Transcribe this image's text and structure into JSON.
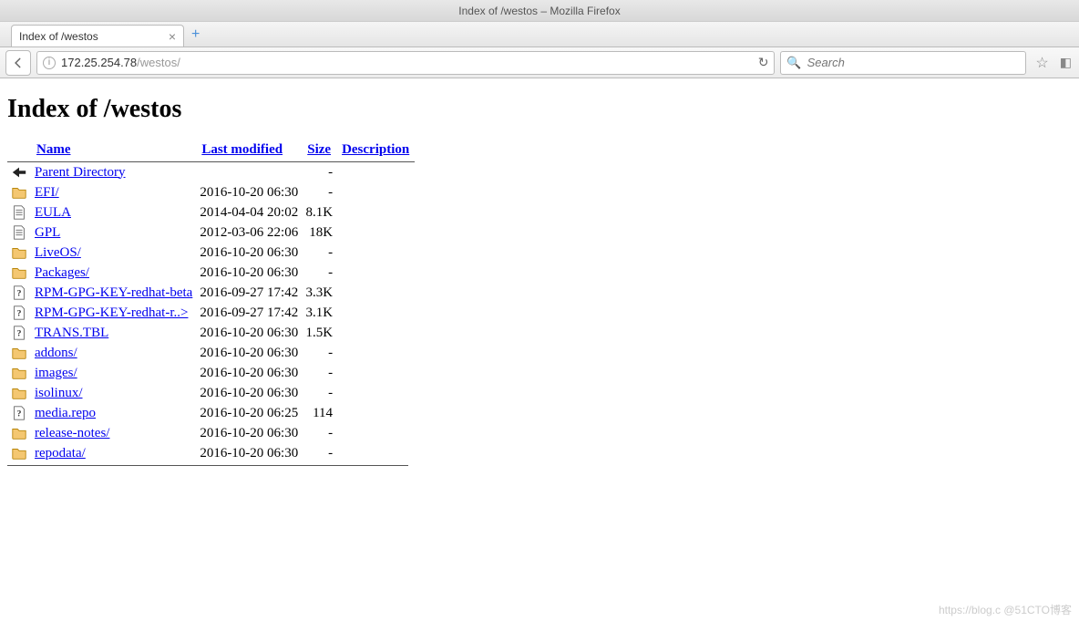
{
  "window_title": "Index of /westos – Mozilla Firefox",
  "tab": {
    "title": "Index of /westos"
  },
  "url": {
    "host": "172.25.254.78",
    "path": "/westos/"
  },
  "search": {
    "placeholder": "Search"
  },
  "page": {
    "heading": "Index of /westos",
    "columns": {
      "name": "Name",
      "modified": "Last modified",
      "size": "Size",
      "desc": "Description"
    },
    "rows": [
      {
        "icon": "back",
        "name": "Parent Directory",
        "modified": "",
        "size": "-",
        "desc": ""
      },
      {
        "icon": "folder",
        "name": "EFI/",
        "modified": "2016-10-20 06:30",
        "size": "-",
        "desc": ""
      },
      {
        "icon": "text",
        "name": "EULA",
        "modified": "2014-04-04 20:02",
        "size": "8.1K",
        "desc": ""
      },
      {
        "icon": "text",
        "name": "GPL",
        "modified": "2012-03-06 22:06",
        "size": "18K",
        "desc": ""
      },
      {
        "icon": "folder",
        "name": "LiveOS/",
        "modified": "2016-10-20 06:30",
        "size": "-",
        "desc": ""
      },
      {
        "icon": "folder",
        "name": "Packages/",
        "modified": "2016-10-20 06:30",
        "size": "-",
        "desc": ""
      },
      {
        "icon": "unknown",
        "name": "RPM-GPG-KEY-redhat-beta",
        "modified": "2016-09-27 17:42",
        "size": "3.3K",
        "desc": ""
      },
      {
        "icon": "unknown",
        "name": "RPM-GPG-KEY-redhat-r..>",
        "modified": "2016-09-27 17:42",
        "size": "3.1K",
        "desc": ""
      },
      {
        "icon": "unknown",
        "name": "TRANS.TBL",
        "modified": "2016-10-20 06:30",
        "size": "1.5K",
        "desc": ""
      },
      {
        "icon": "folder",
        "name": "addons/",
        "modified": "2016-10-20 06:30",
        "size": "-",
        "desc": ""
      },
      {
        "icon": "folder",
        "name": "images/",
        "modified": "2016-10-20 06:30",
        "size": "-",
        "desc": ""
      },
      {
        "icon": "folder",
        "name": "isolinux/",
        "modified": "2016-10-20 06:30",
        "size": "-",
        "desc": ""
      },
      {
        "icon": "unknown",
        "name": "media.repo",
        "modified": "2016-10-20 06:25",
        "size": "114",
        "desc": ""
      },
      {
        "icon": "folder",
        "name": "release-notes/",
        "modified": "2016-10-20 06:30",
        "size": "-",
        "desc": ""
      },
      {
        "icon": "folder",
        "name": "repodata/",
        "modified": "2016-10-20 06:30",
        "size": "-",
        "desc": ""
      }
    ]
  },
  "watermark": "https://blog.c   @51CTO博客"
}
